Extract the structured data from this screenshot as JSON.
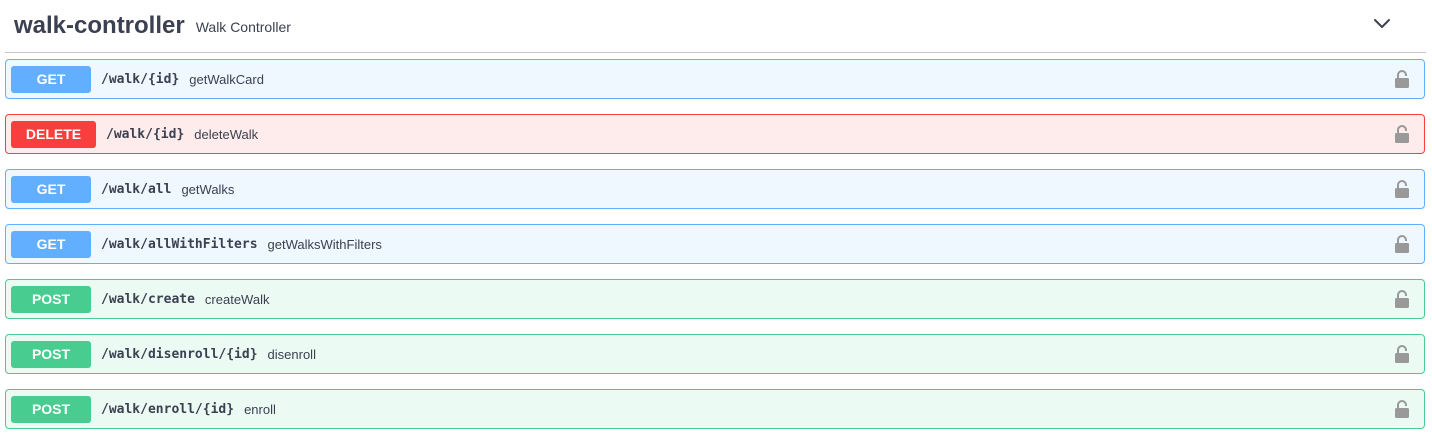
{
  "tag": {
    "name": "walk-controller",
    "description": "Walk Controller",
    "toggle_icon": "chevron-down-icon"
  },
  "operations": [
    {
      "method": "GET",
      "path": "/walk/{id}",
      "summary": "getWalkCard",
      "type": "get"
    },
    {
      "method": "DELETE",
      "path": "/walk/{id}",
      "summary": "deleteWalk",
      "type": "delete"
    },
    {
      "method": "GET",
      "path": "/walk/all",
      "summary": "getWalks",
      "type": "get"
    },
    {
      "method": "GET",
      "path": "/walk/allWithFilters",
      "summary": "getWalksWithFilters",
      "type": "get"
    },
    {
      "method": "POST",
      "path": "/walk/create",
      "summary": "createWalk",
      "type": "post"
    },
    {
      "method": "POST",
      "path": "/walk/disenroll/{id}",
      "summary": "disenroll",
      "type": "post"
    },
    {
      "method": "POST",
      "path": "/walk/enroll/{id}",
      "summary": "enroll",
      "type": "post"
    }
  ],
  "colors": {
    "get": "#61affe",
    "delete": "#f93e3e",
    "post": "#49cc90",
    "text": "#3b4151",
    "lock": "#999999"
  },
  "icons": {
    "lock": "lock-icon"
  }
}
